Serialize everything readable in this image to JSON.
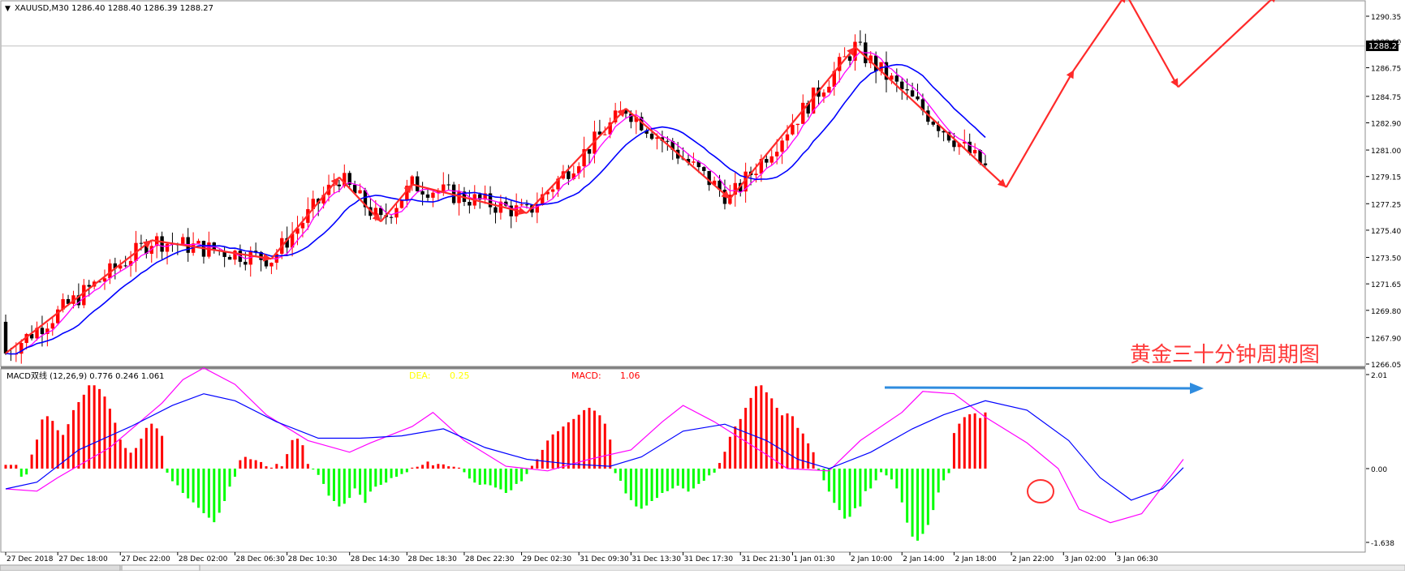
{
  "symbol_header": {
    "marker": "▼",
    "text": "XAUUSD,M30  1286.40 1288.40 1286.39 1288.27"
  },
  "current_price": "1288.27",
  "main_yaxis_labels": [
    "1290.35",
    "1288.60",
    "1286.75",
    "1284.75",
    "1282.90",
    "1281.00",
    "1279.15",
    "1277.25",
    "1275.40",
    "1273.50",
    "1271.65",
    "1269.80",
    "1267.90",
    "1266.05"
  ],
  "macd_header": "MACD双线 (12,26,9) 0.776 0.246 1.061",
  "dea_label": {
    "name": "DEA:",
    "value": "0.25"
  },
  "macd_label": {
    "name": "MACD:",
    "value": "1.06"
  },
  "macd_yaxis_labels": [
    "2.01",
    "0.00",
    "-1.638"
  ],
  "xaxis_labels": [
    "27 Dec 2018",
    "27 Dec 18:00",
    "27 Dec 22:00",
    "28 Dec 02:00",
    "28 Dec 06:30",
    "28 Dec 10:30",
    "28 Dec 14:30",
    "28 Dec 18:30",
    "28 Dec 22:30",
    "29 Dec 02:30",
    "31 Dec 09:30",
    "31 Dec 13:30",
    "31 Dec 17:30",
    "31 Dec 21:30",
    "1 Jan 01:30",
    "2 Jan 10:00",
    "2 Jan 14:00",
    "2 Jan 18:00",
    "2 Jan 22:00",
    "3 Jan 02:00",
    "3 Jan 06:30"
  ],
  "watermark": "黄金三十分钟周期图",
  "colors": {
    "bull": "#ff0000",
    "bear": "#000000",
    "ma_fast": "#ff00ff",
    "ma_slow": "#0000ff",
    "zigzag": "#ff2a2a",
    "macd_pos": "#ff0000",
    "macd_neg": "#00ff00",
    "dea_text": "#ffff00",
    "macd_text": "#ff0000",
    "arrow_blue": "#2f8cdf",
    "circle": "#ff3030",
    "watermark": "#ff3a3a"
  },
  "chart_data": {
    "type": "candlestick",
    "price_range": [
      1266.05,
      1291.0
    ],
    "zigzag_points": [
      [
        0,
        1266.8
      ],
      [
        28,
        1274.7
      ],
      [
        51,
        1273.4
      ],
      [
        64,
        1279.1
      ],
      [
        72,
        1276.0
      ],
      [
        78,
        1278.6
      ],
      [
        100,
        1276.6
      ],
      [
        119,
        1283.9
      ],
      [
        139,
        1277.6
      ],
      [
        163,
        1288.2
      ],
      [
        192,
        1278.4
      ],
      [
        205,
        1286.6
      ],
      [
        215,
        1291.9
      ],
      [
        225,
        1285.4
      ],
      [
        244,
        1291.9
      ]
    ],
    "macd_range": [
      -1.638,
      2.01
    ],
    "macd_hist_values": [
      0.08,
      0.08,
      0.08,
      -0.18,
      -0.13,
      0.3,
      0.62,
      1.05,
      1.12,
      1.02,
      0.82,
      0.72,
      0.95,
      1.25,
      1.42,
      1.58,
      1.78,
      1.78,
      1.7,
      1.54,
      1.28,
      0.98,
      0.62,
      0.44,
      0.34,
      0.44,
      0.64,
      0.87,
      0.96,
      0.86,
      0.7,
      -0.09,
      -0.28,
      -0.37,
      -0.54,
      -0.66,
      -0.75,
      -0.87,
      -0.99,
      -1.09,
      -1.19,
      -0.98,
      -0.72,
      -0.4,
      -0.18,
      0.18,
      0.25,
      0.2,
      0.18,
      0.14,
      0.05,
      0.02,
      0.1,
      0.05,
      0.31,
      0.61,
      0.64,
      0.5,
      0.1,
      -0.02,
      -0.14,
      -0.34,
      -0.6,
      -0.72,
      -0.84,
      -0.78,
      -0.65,
      -0.44,
      -0.58,
      -0.76,
      -0.51,
      -0.4,
      -0.36,
      -0.31,
      -0.21,
      -0.18,
      -0.12,
      -0.08,
      0.02,
      0.04,
      0.08,
      0.15,
      0.07,
      0.1,
      0.09,
      0.05,
      0.04,
      0.02,
      -0.08,
      -0.22,
      -0.31,
      -0.36,
      -0.35,
      -0.37,
      -0.42,
      -0.46,
      -0.54,
      -0.48,
      -0.34,
      -0.28,
      -0.12,
      0.06,
      0.2,
      0.4,
      0.6,
      0.73,
      0.8,
      0.9,
      0.99,
      1.06,
      1.15,
      1.25,
      1.3,
      1.24,
      1.14,
      0.96,
      0.62,
      -0.1,
      -0.27,
      -0.55,
      -0.7,
      -0.84,
      -0.89,
      -0.82,
      -0.72,
      -0.65,
      -0.54,
      -0.5,
      -0.44,
      -0.38,
      -0.44,
      -0.51,
      -0.44,
      -0.34,
      -0.27,
      -0.15,
      -0.09,
      0.12,
      0.36,
      0.68,
      0.9,
      1.06,
      1.3,
      1.51,
      1.76,
      1.78,
      1.63,
      1.5,
      1.3,
      1.14,
      1.18,
      1.12,
      0.87,
      0.75,
      0.54,
      0.35,
      -0.04,
      -0.26,
      -0.51,
      -0.76,
      -0.92,
      -1.11,
      -1.07,
      -0.88,
      -0.84,
      -0.5,
      -0.44,
      -0.26,
      -0.08,
      -0.15,
      -0.24,
      -0.44,
      -0.75,
      -1.2,
      -1.51,
      -1.6,
      -1.45,
      -1.25,
      -0.92,
      -0.53,
      -0.26,
      -0.1,
      0.76,
      0.96,
      1.1,
      1.16,
      1.18,
      1.08,
      1.2
    ],
    "macd_signal_line": [
      [
        0,
        -0.45
      ],
      [
        6,
        -0.5
      ],
      [
        10,
        -0.2
      ],
      [
        20,
        0.45
      ],
      [
        30,
        1.4
      ],
      [
        34,
        1.9
      ],
      [
        38,
        2.15
      ],
      [
        44,
        1.8
      ],
      [
        50,
        1.15
      ],
      [
        58,
        0.6
      ],
      [
        66,
        0.35
      ],
      [
        70,
        0.55
      ],
      [
        78,
        0.9
      ],
      [
        82,
        1.2
      ],
      [
        88,
        0.6
      ],
      [
        96,
        0.05
      ],
      [
        104,
        -0.05
      ],
      [
        112,
        0.2
      ],
      [
        120,
        0.4
      ],
      [
        126,
        1.0
      ],
      [
        130,
        1.35
      ],
      [
        136,
        1.0
      ],
      [
        146,
        0.3
      ],
      [
        150,
        0.0
      ],
      [
        158,
        -0.05
      ],
      [
        164,
        0.6
      ],
      [
        172,
        1.2
      ],
      [
        176,
        1.65
      ],
      [
        182,
        1.6
      ],
      [
        188,
        1.1
      ],
      [
        196,
        0.55
      ],
      [
        202,
        0.0
      ],
      [
        206,
        -0.9
      ],
      [
        212,
        -1.2
      ],
      [
        218,
        -1.0
      ],
      [
        224,
        -0.1
      ],
      [
        226,
        0.2
      ]
    ],
    "macd_main_line": [
      [
        0,
        -0.45
      ],
      [
        6,
        -0.3
      ],
      [
        14,
        0.4
      ],
      [
        24,
        0.9
      ],
      [
        32,
        1.35
      ],
      [
        38,
        1.6
      ],
      [
        44,
        1.45
      ],
      [
        52,
        1.0
      ],
      [
        60,
        0.65
      ],
      [
        68,
        0.65
      ],
      [
        76,
        0.7
      ],
      [
        84,
        0.85
      ],
      [
        92,
        0.45
      ],
      [
        100,
        0.2
      ],
      [
        108,
        0.1
      ],
      [
        116,
        0.05
      ],
      [
        122,
        0.25
      ],
      [
        130,
        0.8
      ],
      [
        138,
        0.95
      ],
      [
        146,
        0.6
      ],
      [
        152,
        0.2
      ],
      [
        158,
        0.0
      ],
      [
        166,
        0.35
      ],
      [
        174,
        0.85
      ],
      [
        180,
        1.15
      ],
      [
        188,
        1.45
      ],
      [
        196,
        1.25
      ],
      [
        204,
        0.6
      ],
      [
        210,
        -0.2
      ],
      [
        216,
        -0.7
      ],
      [
        222,
        -0.45
      ],
      [
        226,
        0.02
      ]
    ],
    "xaxis_label_index": [
      0,
      10,
      22,
      33,
      44,
      54,
      66,
      77,
      88,
      99,
      110,
      120,
      130,
      141,
      151,
      162,
      172,
      182,
      193,
      203,
      213
    ]
  }
}
